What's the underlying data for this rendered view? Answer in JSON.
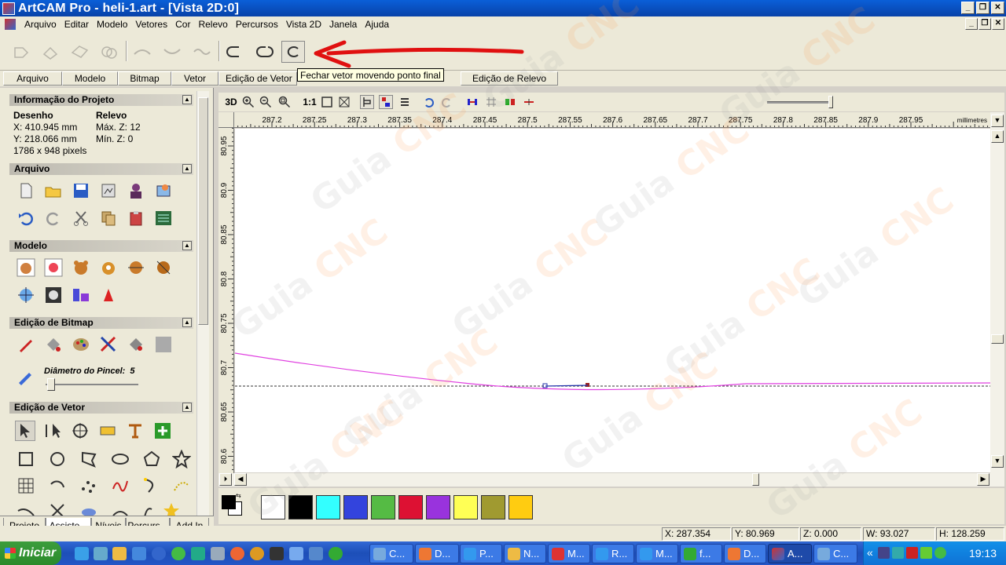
{
  "window": {
    "title": "ArtCAM Pro - heli-1.art - [Vista 2D:0]",
    "btn_min": "_",
    "btn_max": "❐",
    "btn_close": "✕"
  },
  "menu": [
    "Arquivo",
    "Editar",
    "Modelo",
    "Vetores",
    "Cor",
    "Relevo",
    "Percursos",
    "Vista 2D",
    "Janela",
    "Ajuda"
  ],
  "tooltip": "Fechar vetor movendo ponto final",
  "top_tabs": [
    "Arquivo",
    "Modelo",
    "Bitmap",
    "Vetor",
    "Edição de Vetor",
    "Edição de Relevo"
  ],
  "project_info": {
    "header": "Informação do Projeto",
    "col1_title": "Desenho",
    "col2_title": "Relevo",
    "x": "X: 410.945 mm",
    "y": "Y: 218.066 mm",
    "pixels": "1786 x 948 pixels",
    "max_z": "Máx. Z: 12",
    "min_z": "Mín. Z: 0"
  },
  "sections": {
    "arquivo": "Arquivo",
    "modelo": "Modelo",
    "bitmap": "Edição de Bitmap",
    "vetor": "Edição de Vetor"
  },
  "brush": {
    "label": "Diâmetro do Pincel:",
    "value": "5"
  },
  "bottom_tabs": [
    "Projeto",
    "Assiste...",
    "Níveis",
    "Percurs...",
    "Add In"
  ],
  "view_toolbar": {
    "btn_3d": "3D",
    "btn_1to1": "1:1"
  },
  "ruler_top": {
    "labels": [
      "287.2",
      "287.25",
      "287.3",
      "287.35",
      "287.4",
      "287.45",
      "287.5",
      "287.55",
      "287.6",
      "287.65",
      "287.7",
      "287.75",
      "287.8",
      "287.85",
      "287.9",
      "287.95"
    ],
    "unit": "millimetres"
  },
  "ruler_left": {
    "labels": [
      "80.95",
      "80.9",
      "80.85",
      "80.8",
      "80.75",
      "80.7",
      "80.65",
      "80.6"
    ]
  },
  "curve": {
    "color": "#e040e0"
  },
  "palette": [
    "#ffffff",
    "#000000",
    "#33ffff",
    "#3344dd",
    "#55bb44",
    "#dd1133",
    "#9933dd",
    "#ffff55",
    "#a09a30",
    "#ffcc11"
  ],
  "status": {
    "x": "X: 287.354",
    "y": "Y: 80.969",
    "z": "Z: 0.000",
    "w": "W: 93.027",
    "h": "H: 128.259"
  },
  "taskbar": {
    "start": "Iniciar",
    "buttons": [
      "C...",
      "D...",
      "P...",
      "N...",
      "M...",
      "R...",
      "M...",
      "f...",
      "D...",
      "A...",
      "C..."
    ],
    "clock": "19:13"
  },
  "watermark": {
    "word1": "Guia",
    "word2": "CNC"
  }
}
